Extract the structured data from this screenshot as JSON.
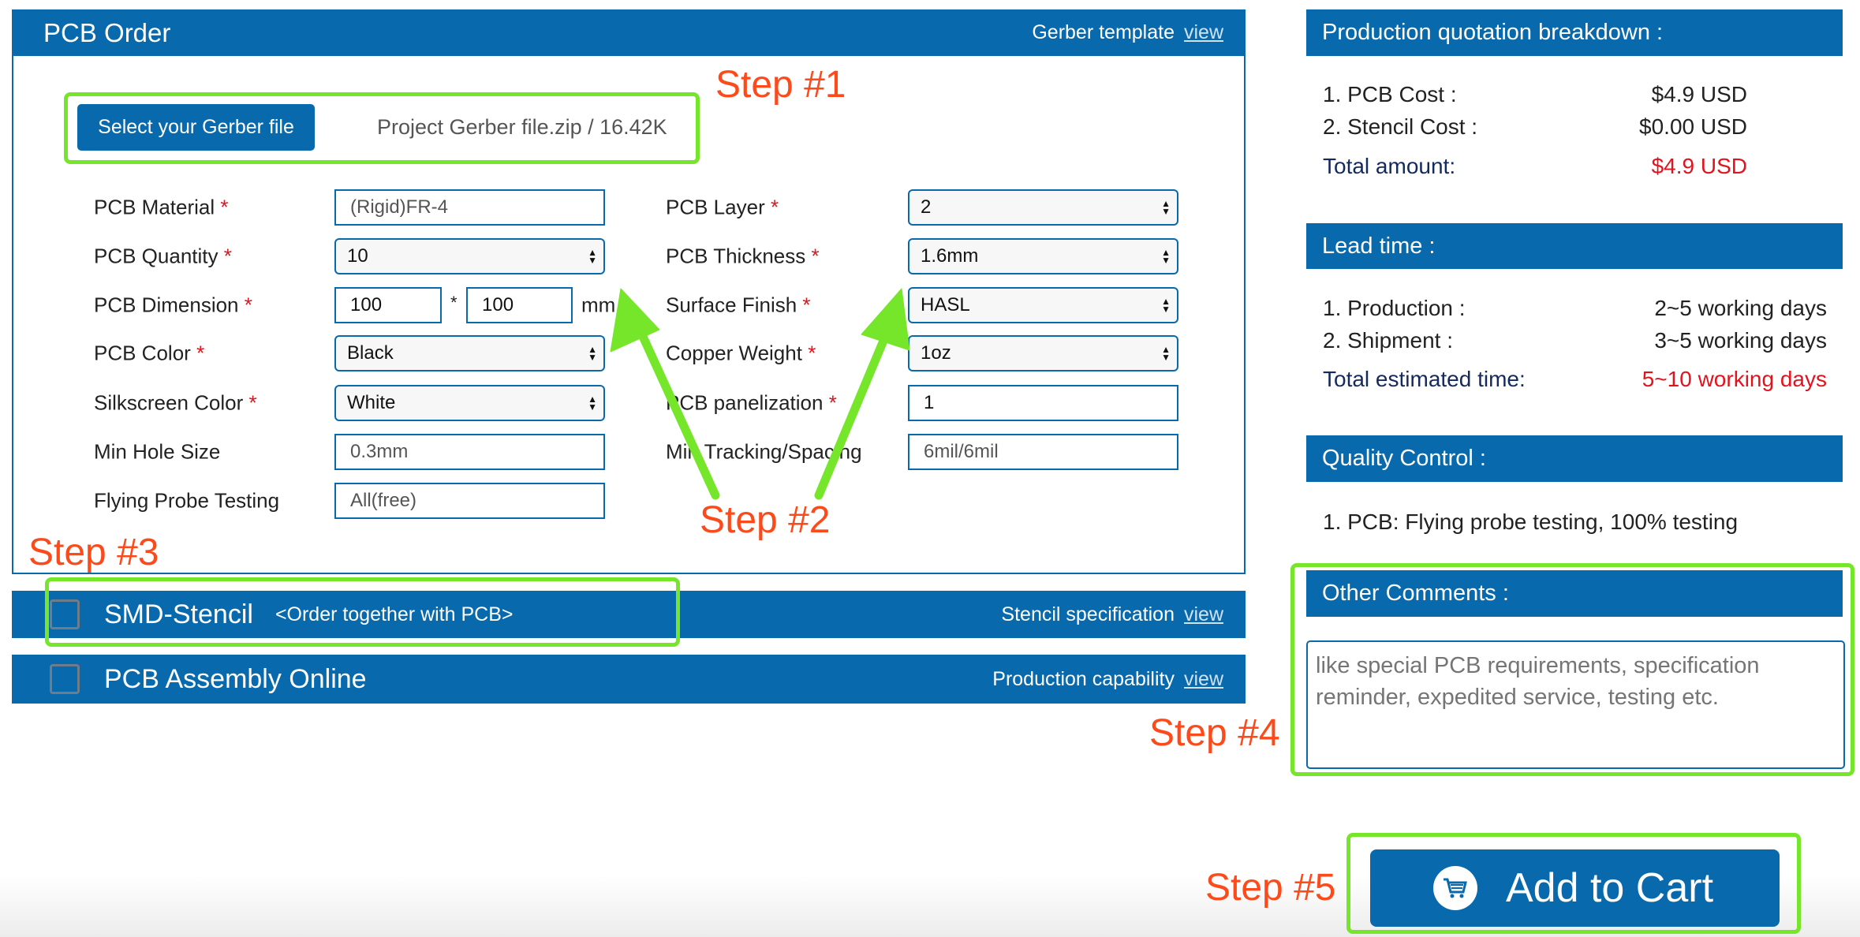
{
  "pcb_order": {
    "title": "PCB Order",
    "template_label": "Gerber template",
    "template_link": "view",
    "upload_button": "Select your Gerber file",
    "file_info": "Project Gerber file.zip / 16.42K",
    "left_fields": [
      {
        "label": "PCB Material",
        "required": "*",
        "value": "(Rigid)FR-4",
        "type": "text"
      },
      {
        "label": "PCB Quantity",
        "required": "*",
        "value": "10",
        "type": "select"
      },
      {
        "label": "PCB Dimension",
        "required": "*",
        "value_x": "100",
        "value_y": "100",
        "sep": "*",
        "unit": "mm"
      },
      {
        "label": "PCB Color",
        "required": "*",
        "value": "Black",
        "type": "select"
      },
      {
        "label": "Silkscreen Color",
        "required": "*",
        "value": "White",
        "type": "select"
      },
      {
        "label": "Min Hole Size",
        "value": "0.3mm",
        "type": "text"
      },
      {
        "label": "Flying Probe Testing",
        "value": "All(free)",
        "type": "text"
      }
    ],
    "right_fields": [
      {
        "label": "PCB Layer",
        "required": "*",
        "value": "2",
        "type": "select"
      },
      {
        "label": "PCB Thickness",
        "required": "*",
        "value": "1.6mm",
        "type": "select"
      },
      {
        "label": "Surface Finish",
        "required": "*",
        "value": "HASL",
        "type": "select"
      },
      {
        "label": "Copper Weight",
        "required": "*",
        "value": "1oz",
        "type": "select"
      },
      {
        "label": "PCB panelization",
        "required": "*",
        "value": "1",
        "type": "text"
      },
      {
        "label": "Min Tracking/Spacing",
        "value": "6mil/6mil",
        "type": "text"
      }
    ]
  },
  "stencil": {
    "title": "SMD-Stencil",
    "note": "<Order together with PCB>",
    "spec_label": "Stencil specification",
    "spec_link": "view",
    "checked": false
  },
  "assembly": {
    "title": "PCB Assembly Online",
    "cap_label": "Production capability",
    "cap_link": "view",
    "checked": false
  },
  "quotation": {
    "title": "Production quotation breakdown :",
    "rows": [
      {
        "label": "1. PCB Cost :",
        "value": "$4.9 USD"
      },
      {
        "label": "2. Stencil Cost :",
        "value": "$0.00 USD"
      }
    ],
    "total_label": "Total amount:",
    "total_value": "$4.9 USD"
  },
  "lead_time": {
    "title": "Lead time :",
    "rows": [
      {
        "label": "1. Production :",
        "value": "2~5 working days"
      },
      {
        "label": "2. Shipment :",
        "value": "3~5 working days"
      }
    ],
    "total_label": "Total estimated time:",
    "total_value": "5~10 working days"
  },
  "quality": {
    "title": "Quality Control :",
    "row": "1. PCB: Flying probe testing, 100% testing"
  },
  "comments": {
    "title": "Other Comments :",
    "placeholder": "like special PCB requirements, specification reminder, expedited service, testing etc."
  },
  "cart": {
    "label": "Add to Cart",
    "icon": "cart-icon"
  },
  "annotations": {
    "step1": "Step #1",
    "step2": "Step #2",
    "step3": "Step #3",
    "step4": "Step #4",
    "step5": "Step #5"
  },
  "colors": {
    "brand_blue": "#0869ad",
    "highlight_green": "#75e62a",
    "step_text": "#fc4a1a",
    "price_red": "#e0141e"
  }
}
